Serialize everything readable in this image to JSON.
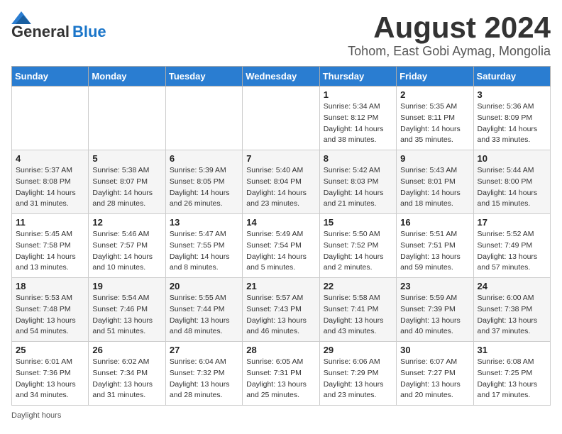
{
  "header": {
    "logo_general": "General",
    "logo_blue": "Blue",
    "title": "August 2024",
    "subtitle": "Tohom, East Gobi Aymag, Mongolia"
  },
  "days_of_week": [
    "Sunday",
    "Monday",
    "Tuesday",
    "Wednesday",
    "Thursday",
    "Friday",
    "Saturday"
  ],
  "weeks": [
    [
      {
        "day": "",
        "info": ""
      },
      {
        "day": "",
        "info": ""
      },
      {
        "day": "",
        "info": ""
      },
      {
        "day": "",
        "info": ""
      },
      {
        "day": "1",
        "info": "Sunrise: 5:34 AM\nSunset: 8:12 PM\nDaylight: 14 hours and 38 minutes."
      },
      {
        "day": "2",
        "info": "Sunrise: 5:35 AM\nSunset: 8:11 PM\nDaylight: 14 hours and 35 minutes."
      },
      {
        "day": "3",
        "info": "Sunrise: 5:36 AM\nSunset: 8:09 PM\nDaylight: 14 hours and 33 minutes."
      }
    ],
    [
      {
        "day": "4",
        "info": "Sunrise: 5:37 AM\nSunset: 8:08 PM\nDaylight: 14 hours and 31 minutes."
      },
      {
        "day": "5",
        "info": "Sunrise: 5:38 AM\nSunset: 8:07 PM\nDaylight: 14 hours and 28 minutes."
      },
      {
        "day": "6",
        "info": "Sunrise: 5:39 AM\nSunset: 8:05 PM\nDaylight: 14 hours and 26 minutes."
      },
      {
        "day": "7",
        "info": "Sunrise: 5:40 AM\nSunset: 8:04 PM\nDaylight: 14 hours and 23 minutes."
      },
      {
        "day": "8",
        "info": "Sunrise: 5:42 AM\nSunset: 8:03 PM\nDaylight: 14 hours and 21 minutes."
      },
      {
        "day": "9",
        "info": "Sunrise: 5:43 AM\nSunset: 8:01 PM\nDaylight: 14 hours and 18 minutes."
      },
      {
        "day": "10",
        "info": "Sunrise: 5:44 AM\nSunset: 8:00 PM\nDaylight: 14 hours and 15 minutes."
      }
    ],
    [
      {
        "day": "11",
        "info": "Sunrise: 5:45 AM\nSunset: 7:58 PM\nDaylight: 14 hours and 13 minutes."
      },
      {
        "day": "12",
        "info": "Sunrise: 5:46 AM\nSunset: 7:57 PM\nDaylight: 14 hours and 10 minutes."
      },
      {
        "day": "13",
        "info": "Sunrise: 5:47 AM\nSunset: 7:55 PM\nDaylight: 14 hours and 8 minutes."
      },
      {
        "day": "14",
        "info": "Sunrise: 5:49 AM\nSunset: 7:54 PM\nDaylight: 14 hours and 5 minutes."
      },
      {
        "day": "15",
        "info": "Sunrise: 5:50 AM\nSunset: 7:52 PM\nDaylight: 14 hours and 2 minutes."
      },
      {
        "day": "16",
        "info": "Sunrise: 5:51 AM\nSunset: 7:51 PM\nDaylight: 13 hours and 59 minutes."
      },
      {
        "day": "17",
        "info": "Sunrise: 5:52 AM\nSunset: 7:49 PM\nDaylight: 13 hours and 57 minutes."
      }
    ],
    [
      {
        "day": "18",
        "info": "Sunrise: 5:53 AM\nSunset: 7:48 PM\nDaylight: 13 hours and 54 minutes."
      },
      {
        "day": "19",
        "info": "Sunrise: 5:54 AM\nSunset: 7:46 PM\nDaylight: 13 hours and 51 minutes."
      },
      {
        "day": "20",
        "info": "Sunrise: 5:55 AM\nSunset: 7:44 PM\nDaylight: 13 hours and 48 minutes."
      },
      {
        "day": "21",
        "info": "Sunrise: 5:57 AM\nSunset: 7:43 PM\nDaylight: 13 hours and 46 minutes."
      },
      {
        "day": "22",
        "info": "Sunrise: 5:58 AM\nSunset: 7:41 PM\nDaylight: 13 hours and 43 minutes."
      },
      {
        "day": "23",
        "info": "Sunrise: 5:59 AM\nSunset: 7:39 PM\nDaylight: 13 hours and 40 minutes."
      },
      {
        "day": "24",
        "info": "Sunrise: 6:00 AM\nSunset: 7:38 PM\nDaylight: 13 hours and 37 minutes."
      }
    ],
    [
      {
        "day": "25",
        "info": "Sunrise: 6:01 AM\nSunset: 7:36 PM\nDaylight: 13 hours and 34 minutes."
      },
      {
        "day": "26",
        "info": "Sunrise: 6:02 AM\nSunset: 7:34 PM\nDaylight: 13 hours and 31 minutes."
      },
      {
        "day": "27",
        "info": "Sunrise: 6:04 AM\nSunset: 7:32 PM\nDaylight: 13 hours and 28 minutes."
      },
      {
        "day": "28",
        "info": "Sunrise: 6:05 AM\nSunset: 7:31 PM\nDaylight: 13 hours and 25 minutes."
      },
      {
        "day": "29",
        "info": "Sunrise: 6:06 AM\nSunset: 7:29 PM\nDaylight: 13 hours and 23 minutes."
      },
      {
        "day": "30",
        "info": "Sunrise: 6:07 AM\nSunset: 7:27 PM\nDaylight: 13 hours and 20 minutes."
      },
      {
        "day": "31",
        "info": "Sunrise: 6:08 AM\nSunset: 7:25 PM\nDaylight: 13 hours and 17 minutes."
      }
    ]
  ],
  "footer": {
    "note": "Daylight hours"
  }
}
